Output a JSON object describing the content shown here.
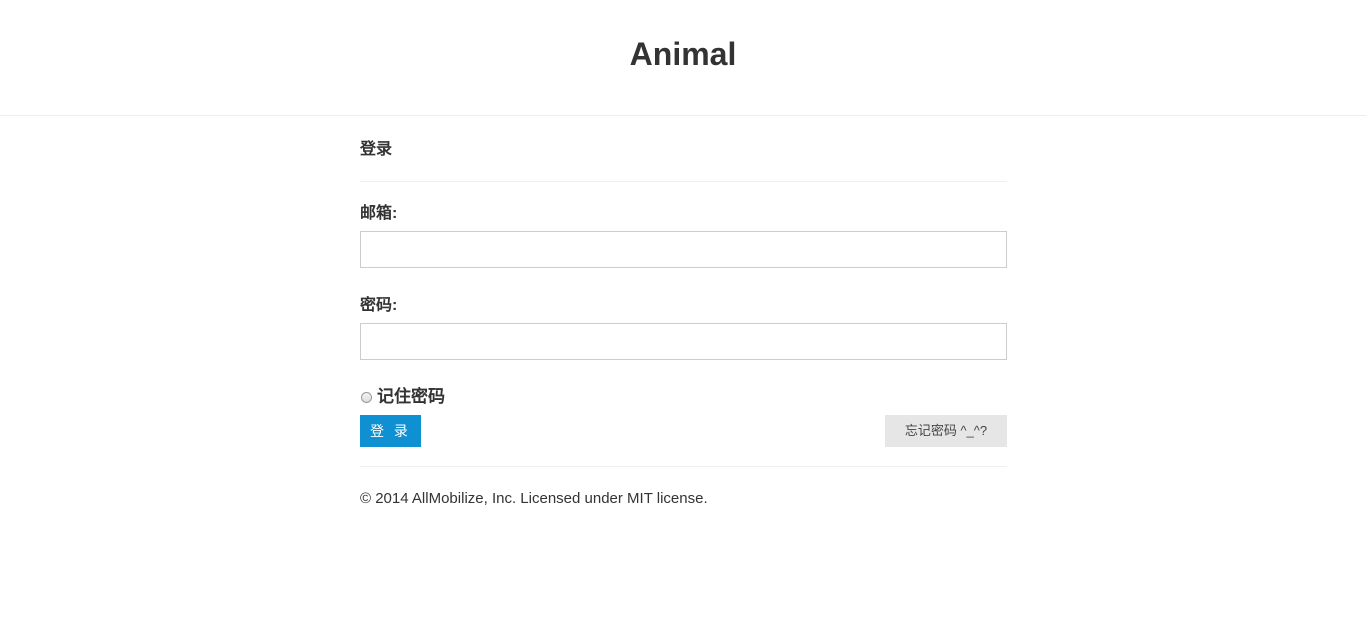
{
  "header": {
    "title": "Animal"
  },
  "form": {
    "heading": "登录",
    "email_label": "邮箱:",
    "email_value": "",
    "password_label": "密码:",
    "password_value": "",
    "remember_label": "记住密码",
    "remember_checked": false,
    "login_button": "登 录",
    "forgot_button": "忘记密码 ^_^?"
  },
  "footer": {
    "text": "© 2014 AllMobilize, Inc. Licensed under MIT license."
  },
  "colors": {
    "primary_button": "#0e90d2",
    "secondary_button": "#e6e6e6"
  }
}
